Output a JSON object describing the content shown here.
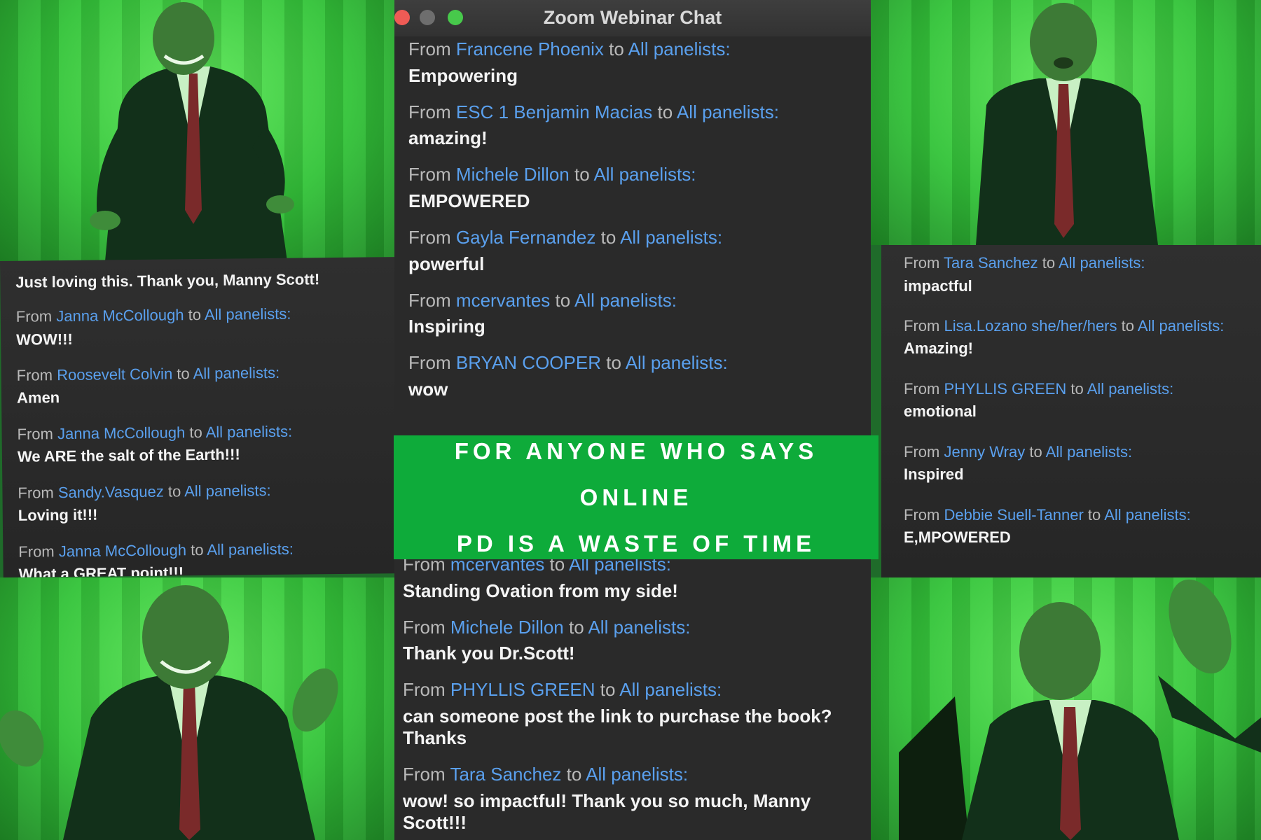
{
  "window": {
    "title": "Zoom Webinar Chat",
    "traffic_lights": [
      "close",
      "minimize",
      "zoom"
    ]
  },
  "banner": {
    "line1": "FOR ANYONE WHO SAYS ONLINE",
    "line2": "PD IS A WASTE OF TIME",
    "color": "#0eab3a"
  },
  "colors": {
    "name_link": "#5aa0ee",
    "chat_background": "#2a2a2a",
    "green_screen": "#34c43a"
  },
  "photos": [
    {
      "name": "speaker-photo-top-left"
    },
    {
      "name": "speaker-photo-top-right"
    },
    {
      "name": "speaker-photo-bottom-left"
    },
    {
      "name": "speaker-photo-bottom-right"
    }
  ],
  "left_chat": {
    "intro": "Just loving this.  Thank you, Manny Scott!",
    "messages": [
      {
        "from_word": "From",
        "sender": "Janna McCollough",
        "to_word": "to",
        "target": "All panelists:",
        "text": "WOW!!!"
      },
      {
        "from_word": "From",
        "sender": "Roosevelt Colvin",
        "to_word": "to",
        "target": "All panelists:",
        "text": "Amen"
      },
      {
        "from_word": "From",
        "sender": "Janna McCollough",
        "to_word": "to",
        "target": "All panelists:",
        "text": "We ARE the salt of the Earth!!!"
      },
      {
        "from_word": "From",
        "sender": "Sandy.Vasquez",
        "to_word": "to",
        "target": "All panelists:",
        "text": "Loving it!!!"
      },
      {
        "from_word": "From",
        "sender": "Janna McCollough",
        "to_word": "to",
        "target": "All panelists:",
        "text": "What a GREAT point!!!"
      }
    ]
  },
  "center_chat": {
    "top_messages": [
      {
        "from_word": "From",
        "sender": "Francene Phoenix",
        "to_word": "to",
        "target": "All panelists:",
        "text": "Empowering"
      },
      {
        "from_word": "From",
        "sender": "ESC 1 Benjamin Macias",
        "to_word": "to",
        "target": "All panelists:",
        "text": "amazing!"
      },
      {
        "from_word": "From",
        "sender": "Michele Dillon",
        "to_word": "to",
        "target": "All panelists:",
        "text": "EMPOWERED"
      },
      {
        "from_word": "From",
        "sender": "Gayla Fernandez",
        "to_word": "to",
        "target": "All panelists:",
        "text": "powerful"
      },
      {
        "from_word": "From",
        "sender": "mcervantes",
        "to_word": "to",
        "target": "All panelists:",
        "text": "Inspiring"
      },
      {
        "from_word": "From",
        "sender": "BRYAN COOPER",
        "to_word": "to",
        "target": "All panelists:",
        "text": "wow"
      }
    ],
    "bottom_messages": [
      {
        "from_word": "From",
        "sender": "mcervantes",
        "to_word": "to",
        "target": "All panelists:",
        "text": "Standing Ovation from my side!"
      },
      {
        "from_word": "From",
        "sender": "Michele Dillon",
        "to_word": "to",
        "target": "All panelists:",
        "text": "Thank you Dr.Scott!"
      },
      {
        "from_word": "From",
        "sender": "PHYLLIS GREEN",
        "to_word": "to",
        "target": "All panelists:",
        "text": "can someone post the link to purchase the book? Thanks"
      },
      {
        "from_word": "From",
        "sender": "Tara Sanchez",
        "to_word": "to",
        "target": "All panelists:",
        "text": "wow! so impactful! Thank you so much, Manny Scott!!!"
      }
    ]
  },
  "right_chat": {
    "messages": [
      {
        "from_word": "From",
        "sender": "Tara Sanchez",
        "to_word": "to",
        "target": "All panelists:",
        "text": "impactful"
      },
      {
        "from_word": "From",
        "sender": "Lisa.Lozano she/her/hers",
        "to_word": "to",
        "target": "All panelists:",
        "text": "Amazing!"
      },
      {
        "from_word": "From",
        "sender": "PHYLLIS GREEN",
        "to_word": "to",
        "target": "All panelists:",
        "text": "emotional"
      },
      {
        "from_word": "From",
        "sender": "Jenny Wray",
        "to_word": "to",
        "target": "All panelists:",
        "text": "Inspired"
      },
      {
        "from_word": "From",
        "sender": "Debbie Suell-Tanner",
        "to_word": "to",
        "target": "All panelists:",
        "text": "E,MPOWERED"
      }
    ]
  }
}
